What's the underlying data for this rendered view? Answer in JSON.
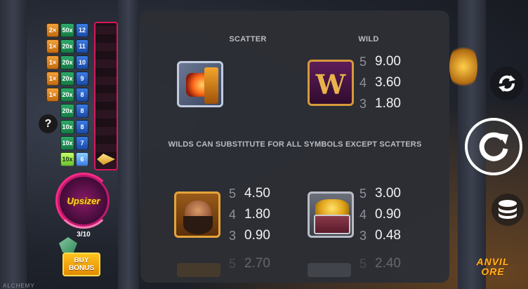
{
  "ladder": {
    "rows": [
      {
        "a": "2×",
        "b": "50x",
        "c": "12",
        "lit": false
      },
      {
        "a": "1×",
        "b": "20x",
        "c": "11",
        "lit": false
      },
      {
        "a": "1×",
        "b": "20x",
        "c": "10",
        "lit": false
      },
      {
        "a": "1×",
        "b": "20x",
        "c": "9",
        "lit": false
      },
      {
        "a": "1×",
        "b": "20x",
        "c": "8",
        "lit": false
      },
      {
        "a": "",
        "b": "20x",
        "c": "8",
        "lit": false
      },
      {
        "a": "",
        "b": "10x",
        "c": "8",
        "lit": false
      },
      {
        "a": "",
        "b": "10x",
        "c": "7",
        "lit": false
      },
      {
        "a": "",
        "b": "10x",
        "c": "6",
        "lit": true
      }
    ]
  },
  "help_label": "?",
  "upsizer": {
    "label": "Upsizer",
    "count": "3/10"
  },
  "buy_bonus": {
    "line1": "BUY",
    "line2": "BONUS"
  },
  "paytable": {
    "scatter_title": "SCATTER",
    "wild_title": "WILD",
    "wild_pays": [
      {
        "count": "5",
        "value": "9.00"
      },
      {
        "count": "4",
        "value": "3.60"
      },
      {
        "count": "3",
        "value": "1.80"
      }
    ],
    "rule_text": "WILDS CAN SUBSTITUTE FOR ALL SYMBOLS EXCEPT SCATTERS",
    "dwarf_pays": [
      {
        "count": "5",
        "value": "4.50"
      },
      {
        "count": "4",
        "value": "1.80"
      },
      {
        "count": "3",
        "value": "0.90"
      }
    ],
    "chest_pays": [
      {
        "count": "5",
        "value": "3.00"
      },
      {
        "count": "4",
        "value": "0.90"
      },
      {
        "count": "3",
        "value": "0.48"
      }
    ],
    "next_left": {
      "count": "5",
      "value": "2.70"
    },
    "next_right": {
      "count": "5",
      "value": "2.40"
    }
  },
  "footer_text": "ALCHEMY",
  "logo": {
    "line1": "ANVIL",
    "line2": "ORE"
  },
  "colors": {
    "panel": "#2c2e35",
    "accent_pink": "#d8175c",
    "gold": "#ffb21e"
  },
  "icons": {
    "autoplay": "autoplay-icon",
    "spin": "spin-icon",
    "bet": "coin-stack-icon"
  }
}
